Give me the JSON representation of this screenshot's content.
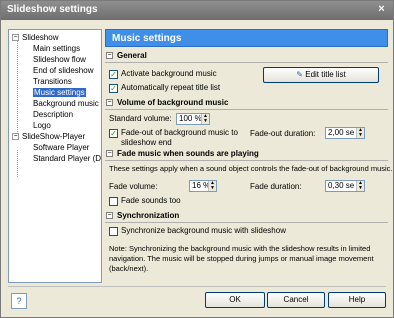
{
  "window": {
    "title": "Slideshow settings",
    "close_glyph": "×"
  },
  "tree": {
    "items": [
      {
        "label": "Slideshow",
        "level": "root",
        "expander": "−"
      },
      {
        "label": "Main settings",
        "level": "child"
      },
      {
        "label": "Slideshow flow",
        "level": "child"
      },
      {
        "label": "End of slideshow",
        "level": "child"
      },
      {
        "label": "Transitions",
        "level": "child"
      },
      {
        "label": "Music settings",
        "level": "child",
        "selected": true
      },
      {
        "label": "Background music",
        "level": "child"
      },
      {
        "label": "Description",
        "level": "child"
      },
      {
        "label": "Logo",
        "level": "child"
      },
      {
        "label": "SlideShow-Player",
        "level": "root",
        "expander": "−"
      },
      {
        "label": "Software Player",
        "level": "child"
      },
      {
        "label": "Standard Player (Di...",
        "level": "child"
      }
    ]
  },
  "panel": {
    "title": "Music settings"
  },
  "general": {
    "title": "General",
    "activate_label": "Activate background music",
    "activate_checked": true,
    "repeat_label": "Automatically repeat title list",
    "repeat_checked": true,
    "edit_button": "Edit title list"
  },
  "volume": {
    "title": "Volume of background music",
    "standard_label": "Standard volume:",
    "standard_value": "100 %",
    "fadeout_label": "Fade-out of background music to slideshow end",
    "fadeout_checked": true,
    "fadeout_duration_label": "Fade-out duration:",
    "fadeout_duration_value": "2,00 se"
  },
  "fade": {
    "title": "Fade music when sounds are playing",
    "description": "These settings apply when a sound object controls the fade-out of background music.",
    "volume_label": "Fade volume:",
    "volume_value": "16 %",
    "duration_label": "Fade duration:",
    "duration_value": "0,30 se",
    "sounds_label": "Fade sounds too",
    "sounds_checked": false
  },
  "sync": {
    "title": "Synchronization",
    "sync_label": "Synchronize background music with slideshow",
    "sync_checked": false,
    "note": "Note: Synchronizing the background music with the slideshow results in limited navigation. The music will be stopped during jumps or manual image movement (back/next)."
  },
  "footer": {
    "ok": "OK",
    "cancel": "Cancel",
    "help": "Help"
  },
  "icons": {
    "section_collapse": "−",
    "check": "✓",
    "spin_up": "▲",
    "spin_down": "▼",
    "help_icon": "?",
    "edit_icon": "✎"
  }
}
